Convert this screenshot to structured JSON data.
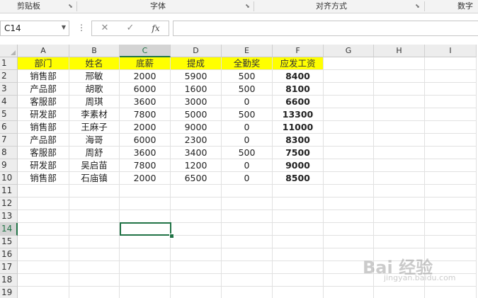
{
  "ribbon": {
    "groups": [
      {
        "label": "剪贴板",
        "launcher": "dialog-launcher-icon"
      },
      {
        "label": "字体",
        "launcher": "dialog-launcher-icon"
      },
      {
        "label": "对齐方式",
        "launcher": "dialog-launcher-icon"
      },
      {
        "label": "数字"
      }
    ]
  },
  "formula_bar": {
    "name_box": "C14",
    "cancel_icon": "✕",
    "enter_icon": "✓",
    "function_icon": "fx",
    "formula": ""
  },
  "grid": {
    "columns": [
      "A",
      "B",
      "C",
      "D",
      "E",
      "F",
      "G",
      "H",
      "I"
    ],
    "rows": [
      "1",
      "2",
      "3",
      "4",
      "5",
      "6",
      "7",
      "8",
      "9",
      "10",
      "11",
      "12",
      "13",
      "14",
      "15",
      "16",
      "17",
      "18",
      "19"
    ],
    "selected_cell": "C14",
    "selected_column": "C",
    "selected_row": "14",
    "header_fill_color": "#ffff00",
    "selection_color": "#217346",
    "table": [
      [
        "部门",
        "姓名",
        "底薪",
        "提成",
        "全勤奖",
        "应发工资"
      ],
      [
        "销售部",
        "邢敏",
        "2000",
        "5900",
        "500",
        "8400"
      ],
      [
        "产品部",
        "胡歌",
        "6000",
        "1600",
        "500",
        "8100"
      ],
      [
        "客服部",
        "周琪",
        "3600",
        "3000",
        "0",
        "6600"
      ],
      [
        "研发部",
        "李素材",
        "7800",
        "5000",
        "500",
        "13300"
      ],
      [
        "销售部",
        "王麻子",
        "2000",
        "9000",
        "0",
        "11000"
      ],
      [
        "产品部",
        "海哥",
        "6000",
        "2300",
        "0",
        "8300"
      ],
      [
        "客服部",
        "周舒",
        "3600",
        "3400",
        "500",
        "7500"
      ],
      [
        "研发部",
        "吴启苗",
        "7800",
        "1200",
        "0",
        "9000"
      ],
      [
        "销售部",
        "石庙镇",
        "2000",
        "6500",
        "0",
        "8500"
      ]
    ]
  },
  "watermark": {
    "brand": "Bai 经验",
    "url": "jingyan.baidu.com"
  }
}
